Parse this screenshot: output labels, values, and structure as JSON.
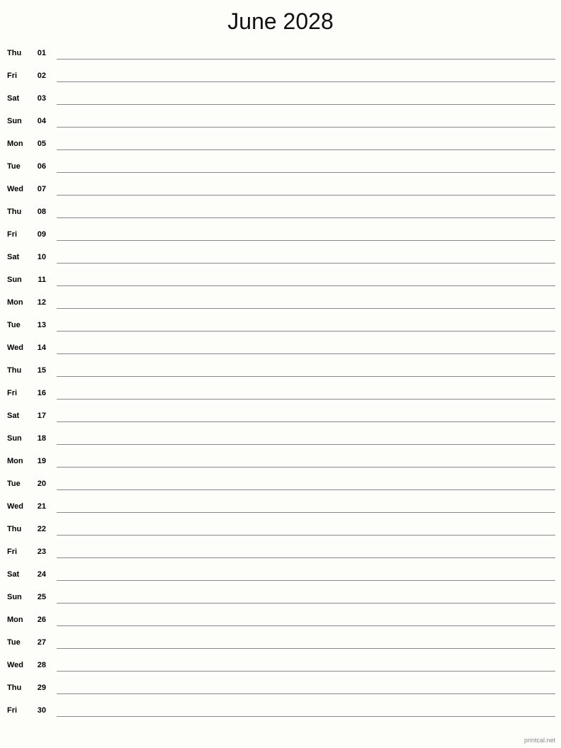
{
  "document": {
    "title": "June 2028",
    "month": "June",
    "year": "2028",
    "layout": "single-column-notes-calendar",
    "paper_background": "#fdfdfa",
    "rule_line_color": "#888888",
    "text_color": "#000000"
  },
  "footer": {
    "credit": "printcal.net",
    "color": "#888888"
  },
  "days": [
    {
      "weekday": "Thu",
      "number": "01"
    },
    {
      "weekday": "Fri",
      "number": "02"
    },
    {
      "weekday": "Sat",
      "number": "03"
    },
    {
      "weekday": "Sun",
      "number": "04"
    },
    {
      "weekday": "Mon",
      "number": "05"
    },
    {
      "weekday": "Tue",
      "number": "06"
    },
    {
      "weekday": "Wed",
      "number": "07"
    },
    {
      "weekday": "Thu",
      "number": "08"
    },
    {
      "weekday": "Fri",
      "number": "09"
    },
    {
      "weekday": "Sat",
      "number": "10"
    },
    {
      "weekday": "Sun",
      "number": "11"
    },
    {
      "weekday": "Mon",
      "number": "12"
    },
    {
      "weekday": "Tue",
      "number": "13"
    },
    {
      "weekday": "Wed",
      "number": "14"
    },
    {
      "weekday": "Thu",
      "number": "15"
    },
    {
      "weekday": "Fri",
      "number": "16"
    },
    {
      "weekday": "Sat",
      "number": "17"
    },
    {
      "weekday": "Sun",
      "number": "18"
    },
    {
      "weekday": "Mon",
      "number": "19"
    },
    {
      "weekday": "Tue",
      "number": "20"
    },
    {
      "weekday": "Wed",
      "number": "21"
    },
    {
      "weekday": "Thu",
      "number": "22"
    },
    {
      "weekday": "Fri",
      "number": "23"
    },
    {
      "weekday": "Sat",
      "number": "24"
    },
    {
      "weekday": "Sun",
      "number": "25"
    },
    {
      "weekday": "Mon",
      "number": "26"
    },
    {
      "weekday": "Tue",
      "number": "27"
    },
    {
      "weekday": "Wed",
      "number": "28"
    },
    {
      "weekday": "Thu",
      "number": "29"
    },
    {
      "weekday": "Fri",
      "number": "30"
    }
  ]
}
